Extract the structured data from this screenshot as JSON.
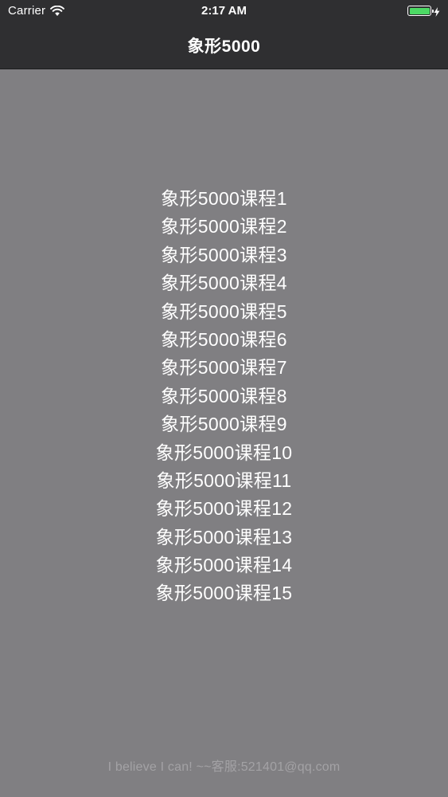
{
  "status_bar": {
    "carrier": "Carrier",
    "time": "2:17 AM",
    "battery_level": 1.0,
    "battery_color": "#4cd964"
  },
  "nav": {
    "title": "象形5000"
  },
  "courses": [
    "象形5000课程1",
    "象形5000课程2",
    "象形5000课程3",
    "象形5000课程4",
    "象形5000课程5",
    "象形5000课程6",
    "象形5000课程7",
    "象形5000课程8",
    "象形5000课程9",
    "象形5000课程10",
    "象形5000课程11",
    "象形5000课程12",
    "象形5000课程13",
    "象形5000课程14",
    "象形5000课程15"
  ],
  "footer": {
    "text": "I believe I can! ~~客服:521401@qq.com"
  },
  "icons": {
    "wifi": "wifi-icon",
    "battery": "battery-icon",
    "charging": "bolt-icon"
  },
  "colors": {
    "background": "#807f82",
    "nav_bar": "#2f2f31",
    "text": "#ffffff",
    "footer_text": "#a3a2a5"
  }
}
